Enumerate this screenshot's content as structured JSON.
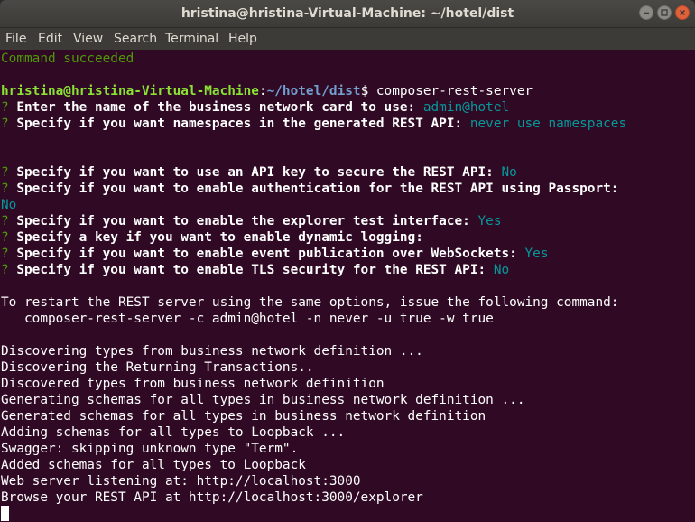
{
  "window": {
    "title": "hristina@hristina-Virtual-Machine: ~/hotel/dist"
  },
  "menu": [
    "File",
    "Edit",
    "View",
    "Search",
    "Terminal",
    "Help"
  ],
  "terminal": {
    "status": "Command succeeded",
    "prompt": {
      "user_host": "hristina@hristina-Virtual-Machine",
      "sep": ":",
      "path": "~/hotel/dist",
      "symbol": "$ ",
      "command": "composer-rest-server"
    },
    "q_mark": "?",
    "questions": {
      "q1_text": " Enter the name of the business network card to use: ",
      "q1_ans": "admin@hotel",
      "q2_text": " Specify if you want namespaces in the generated REST API: ",
      "q2_ans": "never use namespaces",
      "q3_text": " Specify if you want to use an API key to secure the REST API: ",
      "q3_ans": "No",
      "q4_text": " Specify if you want to enable authentication for the REST API using Passport:",
      "q4_ans": "No",
      "q5_text": " Specify if you want to enable the explorer test interface: ",
      "q5_ans": "Yes",
      "q6_text": " Specify a key if you want to enable dynamic logging:",
      "q7_text": " Specify if you want to enable event publication over WebSockets: ",
      "q7_ans": "Yes",
      "q8_text": " Specify if you want to enable TLS security for the REST API: ",
      "q8_ans": "No"
    },
    "restart_msg": "To restart the REST server using the same options, issue the following command:",
    "restart_cmd": "   composer-rest-server -c admin@hotel -n never -u true -w true",
    "log": [
      "Discovering types from business network definition ...",
      "Discovering the Returning Transactions..",
      "Discovered types from business network definition",
      "Generating schemas for all types in business network definition ...",
      "Generated schemas for all types in business network definition",
      "Adding schemas for all types to Loopback ...",
      "Swagger: skipping unknown type \"Term\".",
      "Added schemas for all types to Loopback",
      "Web server listening at: http://localhost:3000",
      "Browse your REST API at http://localhost:3000/explorer"
    ]
  }
}
